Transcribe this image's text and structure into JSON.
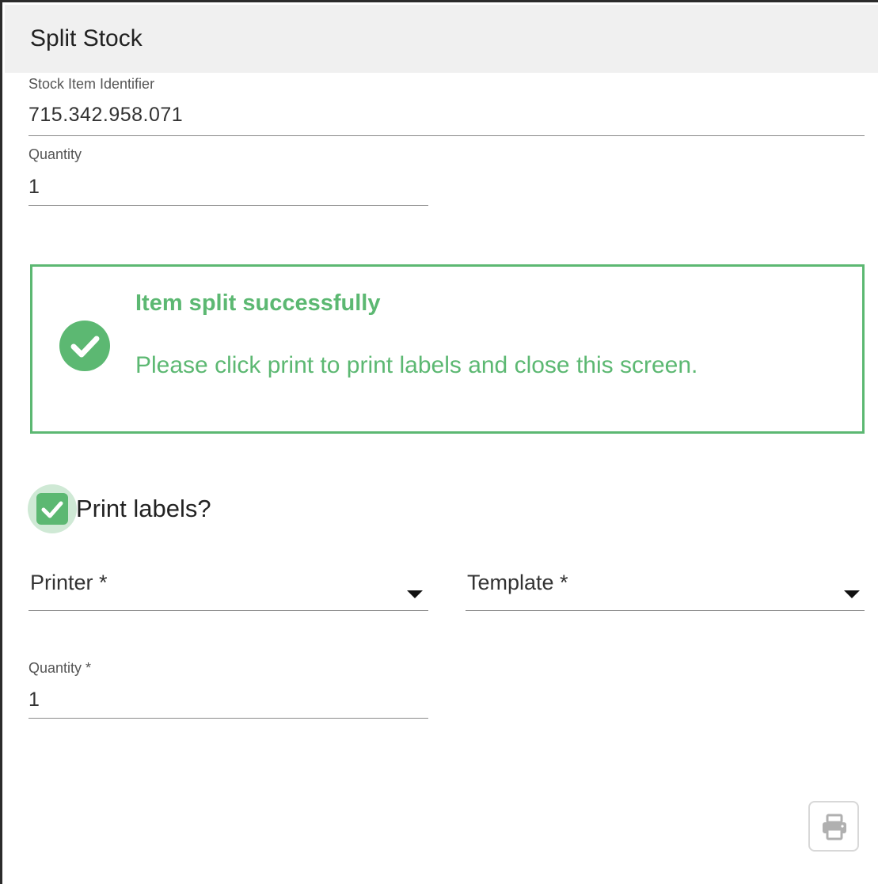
{
  "dialog": {
    "title": "Split Stock"
  },
  "form": {
    "stock_item_identifier": {
      "label": "Stock Item Identifier",
      "value": "715.342.958.071"
    },
    "quantity": {
      "label": "Quantity",
      "value": "1"
    }
  },
  "alert": {
    "title": "Item split successfully",
    "message": "Please click print to print labels and close this screen.",
    "icon": "check-circle-icon",
    "color": "#5cb872"
  },
  "print_options": {
    "print_labels": {
      "label": "Print labels?",
      "checked": true
    },
    "printer": {
      "label": "Printer *",
      "value": ""
    },
    "template": {
      "label": "Template *",
      "value": ""
    },
    "label_quantity": {
      "label": "Quantity *",
      "value": "1"
    }
  },
  "actions": {
    "print_icon": "printer-icon"
  }
}
